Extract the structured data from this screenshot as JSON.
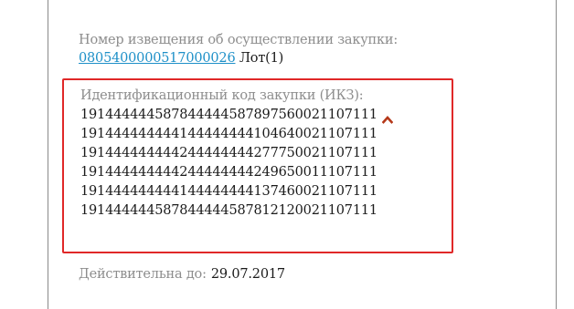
{
  "notice": {
    "label": "Номер извещения об осуществлении закупки:",
    "number": "0805400000517000026",
    "lot": "Лот(1)"
  },
  "ikz": {
    "label": "Идентификационный код закупки (ИКЗ):",
    "codes": [
      "191444444587844444587897560021107111",
      "191444444444144444444104640021107111",
      "191444444444244444444277750021107111",
      "191444444444244444444249650011107111",
      "191444444444144444444137460021107111",
      "191444444587844444587812120021107111"
    ],
    "collapse_icon": "chevron-up-icon",
    "collapse_icon_color": "#b5391a"
  },
  "validity": {
    "label": "Действительна до:",
    "date": "29.07.2017"
  },
  "colors": {
    "highlight_border": "#e02828",
    "link": "#1e90c8",
    "label_text": "#8d8d8d"
  }
}
